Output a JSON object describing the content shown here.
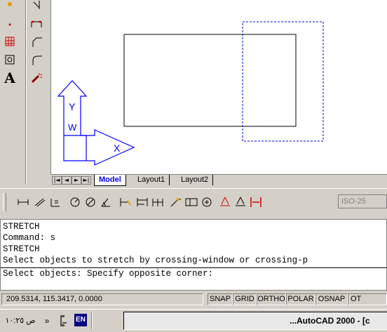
{
  "layout_tabs": [
    "Model",
    "Layout1",
    "Layout2"
  ],
  "nav_buttons": [
    "|◄",
    "◄",
    "►",
    "►|"
  ],
  "ucs_labels": {
    "y": "Y",
    "w": "W",
    "x": "X"
  },
  "dim_style": "ISO-25",
  "command_lines": [
    "STRETCH",
    "Command: s",
    "STRETCH",
    "Select objects to stretch by crossing-window or crossing-p",
    "Select objects: Specify opposite corner:"
  ],
  "status": {
    "coordinates": "209.5314, 115.3417, 0.0000",
    "toggles": [
      "SNAP",
      "GRID",
      "ORTHO",
      "POLAR",
      "OSNAP",
      "OT"
    ]
  },
  "taskbar": {
    "clock": "ص ١٠:٢٥",
    "chevron": "»",
    "language": "EN",
    "app_button": "...AutoCAD 2000 - [c"
  },
  "colors": {
    "accent_blue": "#0000ff",
    "drawing_bg": "#ffffff",
    "ui_gray": "#d4d0c8"
  }
}
